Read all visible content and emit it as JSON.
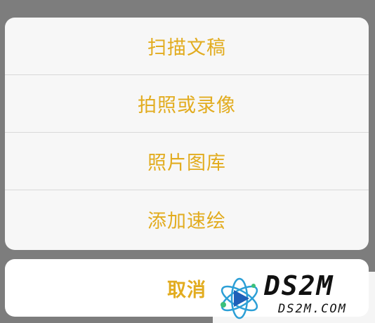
{
  "action_sheet": {
    "items": [
      {
        "label": "扫描文稿"
      },
      {
        "label": "拍照或录像"
      },
      {
        "label": "照片图库"
      },
      {
        "label": "添加速绘"
      }
    ],
    "cancel_label": "取消"
  },
  "watermark": {
    "title": "DS2M",
    "domain": "DS2M.COM"
  },
  "colors": {
    "accent": "#e2ac1f",
    "overlay": "#7d7d7d",
    "sheet_bg": "#f7f7f7",
    "separator": "#d9d9d9"
  }
}
